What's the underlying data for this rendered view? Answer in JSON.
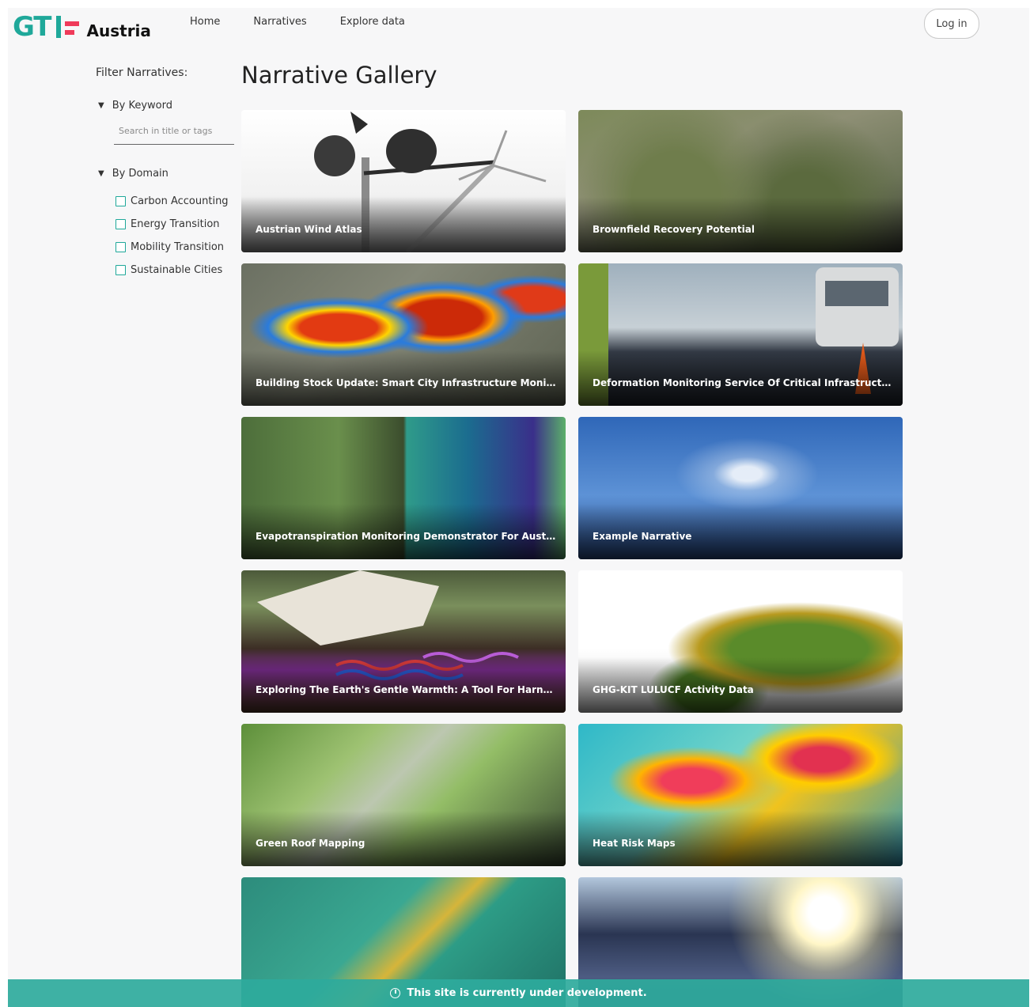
{
  "brand": {
    "mark": "GTIF",
    "country": "Austria"
  },
  "nav": {
    "home": "Home",
    "narratives": "Narratives",
    "explore": "Explore data",
    "login": "Log in"
  },
  "sidebar": {
    "title": "Filter Narratives:",
    "keyword_section": "By Keyword",
    "search_placeholder": "Search in title or tags",
    "domain_section": "By Domain",
    "domains": [
      "Carbon Accounting",
      "Energy Transition",
      "Mobility Transition",
      "Sustainable Cities"
    ]
  },
  "main": {
    "title": "Narrative Gallery",
    "cards": [
      "Austrian Wind Atlas",
      "Brownfield Recovery Potential",
      "Building Stock Update: Smart City Infrastructure Monit...",
      "Deformation Monitoring Service Of Critical Infrastructu...",
      "Evapotranspiration Monitoring Demonstrator For Austria",
      "Example Narrative",
      "Exploring The Earth's Gentle Warmth: A Tool For Harne...",
      "GHG-KIT LULUCF Activity Data",
      "Green Roof Mapping",
      "Heat Risk Maps",
      "",
      ""
    ]
  },
  "banner": {
    "text": "This site is currently under development."
  }
}
